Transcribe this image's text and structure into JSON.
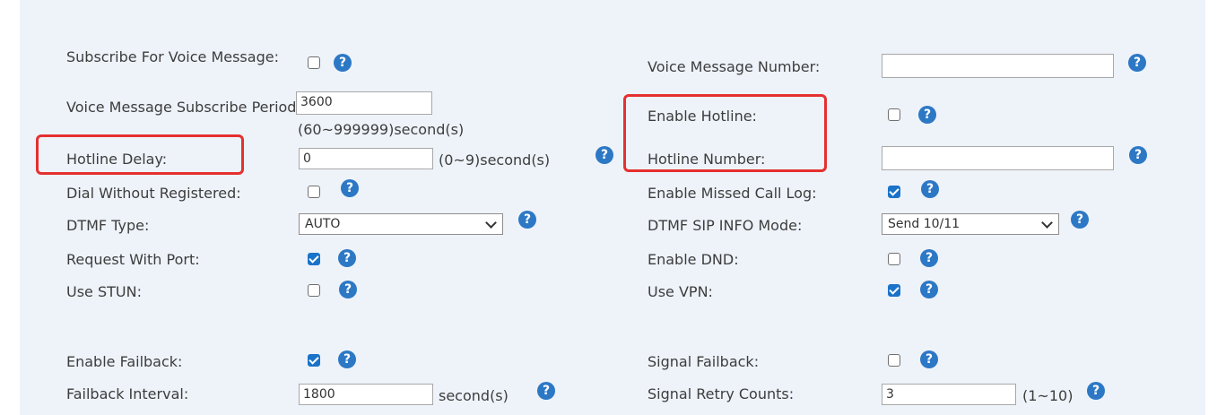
{
  "left": {
    "subscribe_voice_message": {
      "label": "Subscribe For Voice Message:",
      "checked": false
    },
    "voice_message_subscribe_period": {
      "label": "Voice Message Subscribe Period:",
      "value": "3600",
      "hint": "(60~999999)second(s)"
    },
    "hotline_delay": {
      "label": "Hotline Delay:",
      "value": "0",
      "hint": "(0~9)second(s)"
    },
    "dial_without_registered": {
      "label": "Dial Without Registered:",
      "checked": false
    },
    "dtmf_type": {
      "label": "DTMF Type:",
      "value": "AUTO"
    },
    "request_with_port": {
      "label": "Request With Port:",
      "checked": true
    },
    "use_stun": {
      "label": "Use STUN:",
      "checked": false
    },
    "enable_failback": {
      "label": "Enable Failback:",
      "checked": true
    },
    "failback_interval": {
      "label": "Failback Interval:",
      "value": "1800",
      "hint": "second(s)"
    }
  },
  "right": {
    "voice_message_number": {
      "label": "Voice Message Number:",
      "value": ""
    },
    "enable_hotline": {
      "label": "Enable Hotline:",
      "checked": false
    },
    "hotline_number": {
      "label": "Hotline Number:",
      "value": ""
    },
    "enable_missed_call_log": {
      "label": "Enable Missed Call Log:",
      "checked": true
    },
    "dtmf_sip_info_mode": {
      "label": "DTMF SIP INFO Mode:",
      "value": "Send 10/11"
    },
    "enable_dnd": {
      "label": "Enable DND:",
      "checked": false
    },
    "use_vpn": {
      "label": "Use VPN:",
      "checked": true
    },
    "signal_failback": {
      "label": "Signal Failback:",
      "checked": false
    },
    "signal_retry_counts": {
      "label": "Signal Retry Counts:",
      "value": "3",
      "hint": "(1~10)"
    }
  },
  "help_glyph": "?",
  "colors": {
    "accent": "#2d78c5",
    "highlight": "#e53030",
    "panel": "#eef3fa"
  }
}
